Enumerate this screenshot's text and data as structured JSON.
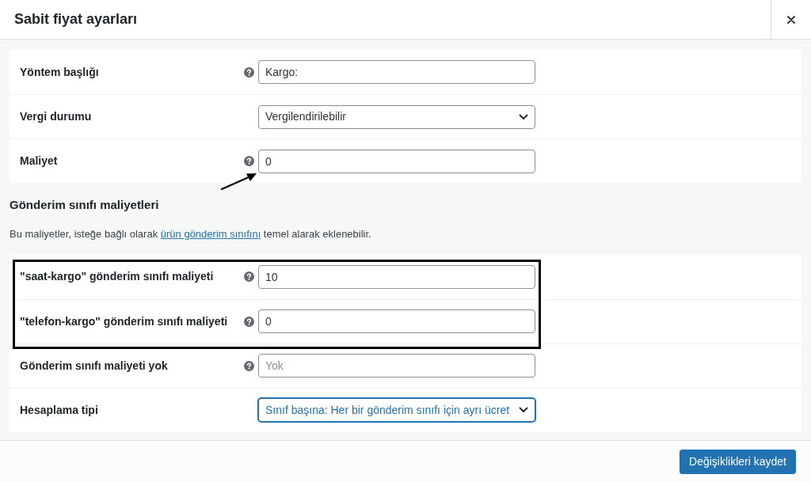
{
  "dialog": {
    "title": "Sabit fiyat ayarları"
  },
  "method_fields": [
    {
      "kind": "text",
      "label": "Yöntem başlığı",
      "help": true,
      "value": "Kargo:",
      "focused": false,
      "arrow": false
    },
    {
      "kind": "select",
      "label": "Vergi durumu",
      "help": false,
      "value": "Vergilendirilebilir",
      "focused": false,
      "arrow": false
    },
    {
      "kind": "text",
      "label": "Maliyet",
      "help": true,
      "value": "0",
      "focused": false,
      "arrow": true
    }
  ],
  "class_costs": {
    "heading": "Gönderim sınıfı maliyetleri",
    "description": [
      {
        "kind": "text",
        "text": "Bu maliyetler, isteğe bağlı olarak "
      },
      {
        "kind": "link",
        "text": "ürün gönderim sınıfını"
      },
      {
        "kind": "text",
        "text": " temel alarak eklenebilir."
      }
    ],
    "fields": [
      {
        "kind": "text",
        "label": "\"saat-kargo\" gönderim sınıfı maliyeti",
        "help": true,
        "value": "10",
        "focused": false,
        "highlighted": true
      },
      {
        "kind": "text",
        "label": "\"telefon-kargo\" gönderim sınıfı maliyeti",
        "help": true,
        "value": "0",
        "focused": false,
        "highlighted": true
      },
      {
        "kind": "text",
        "label": "Gönderim sınıfı maliyeti yok",
        "help": true,
        "placeholder": "Yok",
        "focused": false,
        "highlighted": false
      },
      {
        "kind": "select",
        "label": "Hesaplama tipi",
        "help": false,
        "value": "Sınıf başına: Her bir gönderim sınıfı için ayrı ücret",
        "focused": true,
        "highlighted": false
      }
    ]
  },
  "footer": {
    "save_button": "Değişiklikleri kaydet"
  }
}
